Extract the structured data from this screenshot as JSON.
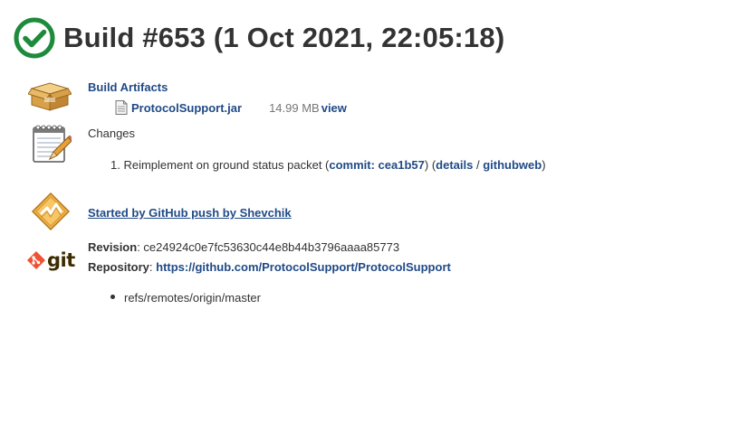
{
  "build": {
    "title": "Build #653 (1 Oct 2021, 22:05:18)",
    "status_icon": "check-circle-icon",
    "status_color": "#1e8a3c"
  },
  "artifacts": {
    "title": "Build Artifacts",
    "icon": "package-box-icon",
    "items": [
      {
        "name": "ProtocolSupport.jar",
        "size": "14.99 MB",
        "view_label": "view",
        "icon": "file-icon"
      }
    ]
  },
  "changes": {
    "title": "Changes",
    "icon": "notepad-pencil-icon",
    "items": [
      {
        "number": "1.",
        "message": "Reimplement on ground status packet",
        "commit_label": "commit: cea1b57",
        "details_label": "details",
        "githubweb_label": "githubweb"
      }
    ]
  },
  "cause": {
    "icon": "github-push-icon",
    "text": "Started by GitHub push by Shevchik"
  },
  "git": {
    "logo_text": "git",
    "revision_label": "Revision",
    "revision": "ce24924c0e7fc53630c44e8b44b3796aaaa85773",
    "repository_label": "Repository",
    "repository_url": "https://github.com/ProtocolSupport/ProtocolSupport",
    "branches": [
      "refs/remotes/origin/master"
    ]
  },
  "colors": {
    "link": "#204a87",
    "text": "#333333",
    "muted": "#777777",
    "git_orange": "#f05133"
  }
}
